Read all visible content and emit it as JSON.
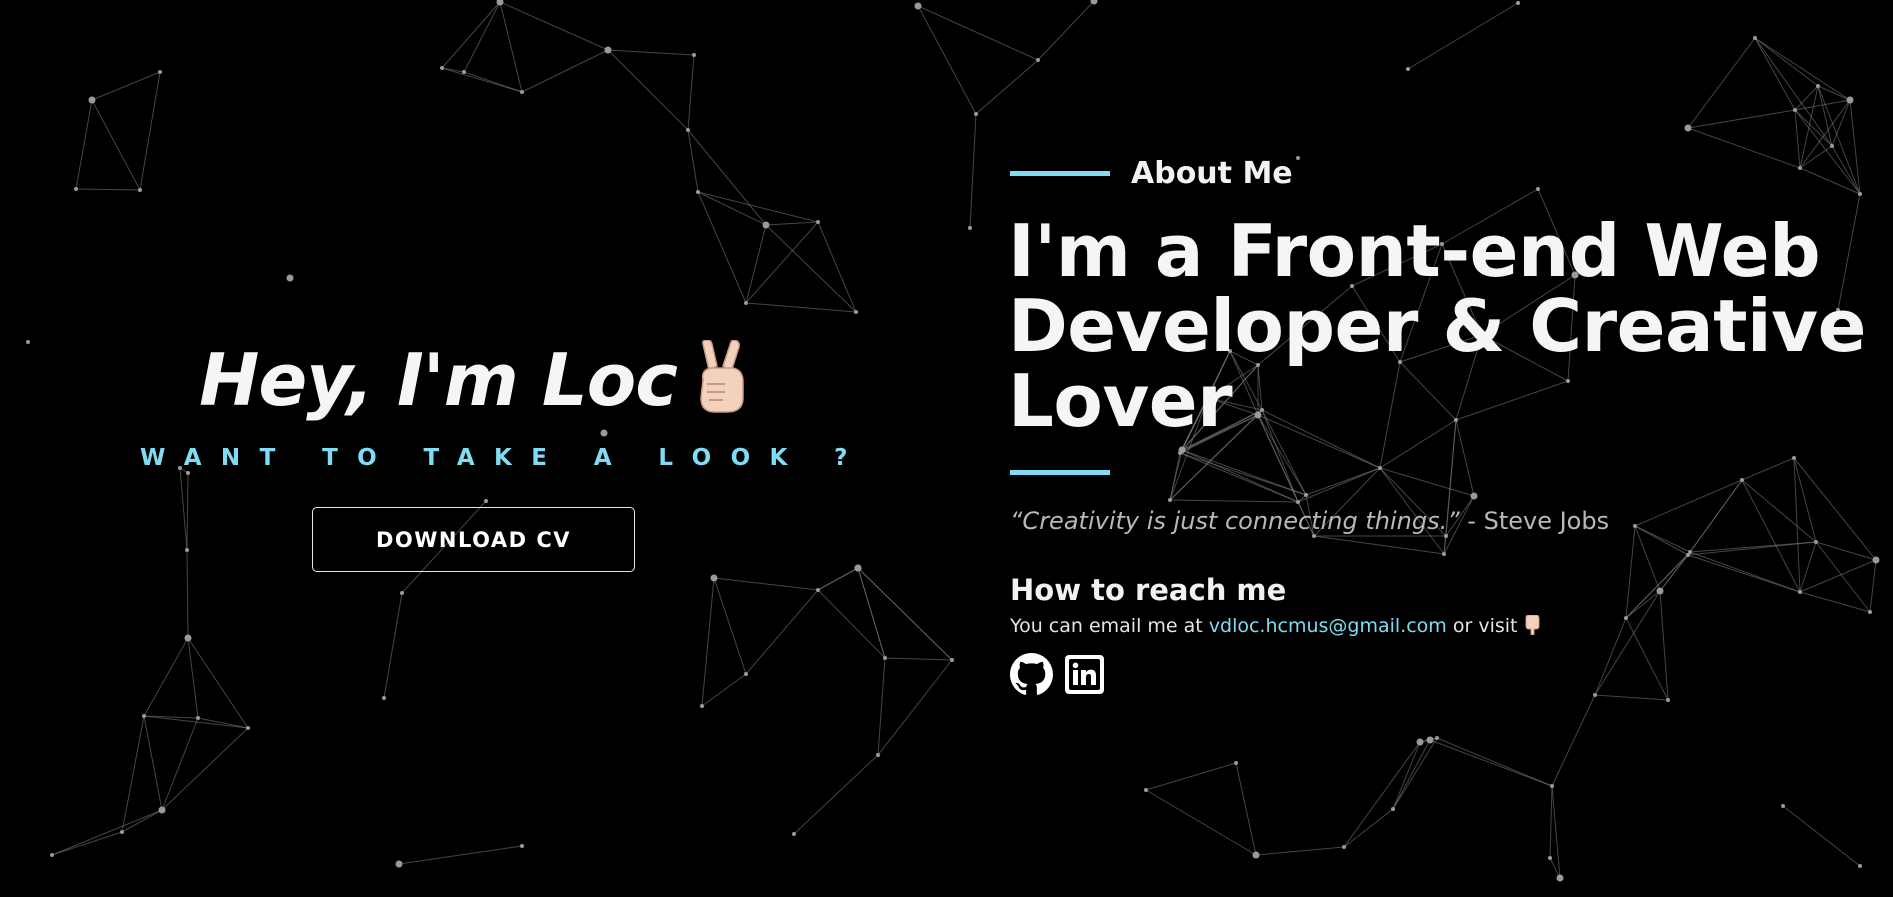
{
  "hero": {
    "title": "Hey, I'm Loc",
    "emoji_icon": "victory-hand-icon",
    "tagline": "WANT TO TAKE A LOOK ?",
    "download_label": "DOWNLOAD CV"
  },
  "about": {
    "section_label": "About Me",
    "title_lines": [
      "I'm a Front-end Web",
      "Developer & Creative",
      "Lover"
    ],
    "quote_text": "“Creativity is just connecting things.”",
    "quote_author": " - Steve Jobs",
    "reach_title": "How to reach me",
    "reach_prefix": "You can email me at ",
    "email": "vdloc.hcmus@gmail.com",
    "reach_suffix": " or visit ",
    "pointing_icon": "pointing-down-icon",
    "social": [
      {
        "icon": "github-icon"
      },
      {
        "icon": "linkedin-icon"
      }
    ]
  },
  "theme": {
    "background": "#000000",
    "accent": "#7fdcf2",
    "text": "#f5f5f5",
    "muted": "#b8b8b8",
    "network_color": "#7d7d7d"
  }
}
